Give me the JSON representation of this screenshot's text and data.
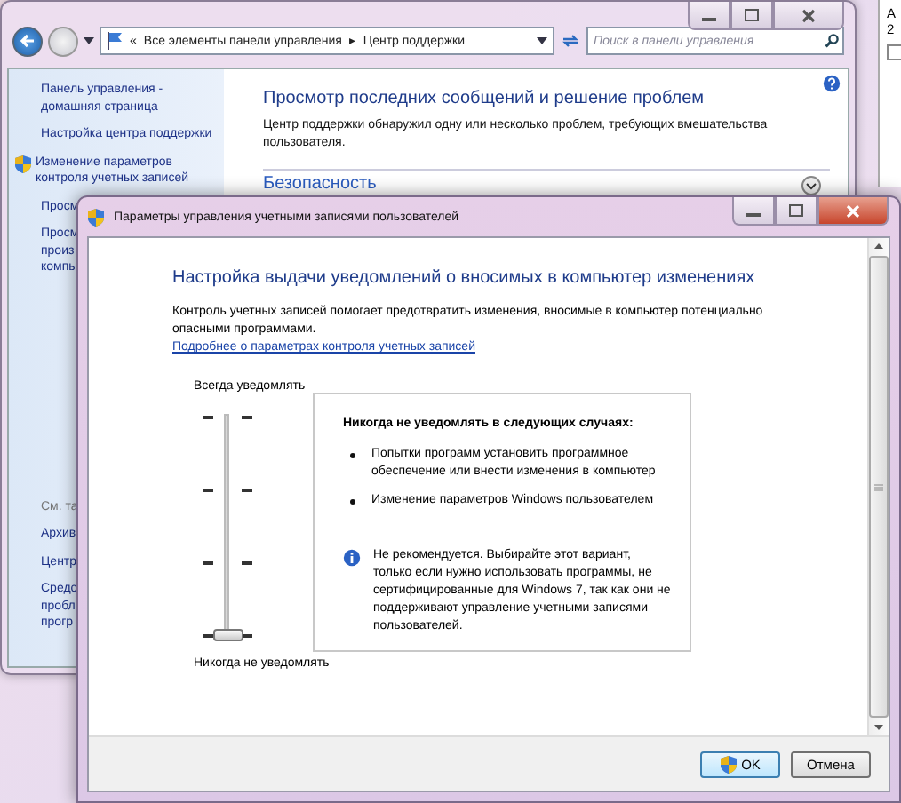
{
  "control_panel": {
    "nav": {
      "breadcrumb": [
        "«",
        "Все элементы панели управления",
        "▸",
        "Центр поддержки"
      ],
      "search": {
        "placeholder": "Поиск в панели управления"
      }
    },
    "sidebar": {
      "links": [
        {
          "lines": [
            "Панель управления -",
            "домашняя страница"
          ],
          "shield": false
        },
        {
          "lines": [
            "Настройка центра поддержки"
          ],
          "shield": false
        },
        {
          "lines": [
            "Изменение параметров",
            "контроля учетных записей"
          ],
          "shield": true
        },
        {
          "lines": [
            "Просм"
          ],
          "shield": false
        },
        {
          "lines": [
            "Просм",
            "произ",
            "компь"
          ],
          "shield": false
        }
      ],
      "see_also": {
        "heading": "См. та",
        "links": [
          {
            "lines": [
              "Архив"
            ]
          },
          {
            "lines": [
              "Центр"
            ]
          },
          {
            "lines": [
              "Средс",
              "пробл",
              "прогр"
            ]
          }
        ]
      }
    },
    "main": {
      "title": "Просмотр последних сообщений и решение проблем",
      "description": "Центр поддержки обнаружил одну или несколько проблем, требующих вмешательства пользователя.",
      "section": "Безопасность"
    }
  },
  "side_window": {
    "texts": [
      "А",
      "2"
    ],
    "checkbox": {
      "checked": false
    }
  },
  "uac_dialog": {
    "window": {
      "title": "Параметры управления учетными записями пользователей"
    },
    "heading": "Настройка выдачи уведомлений о вносимых в компьютер изменениях",
    "description": "Контроль учетных записей помогает предотвратить изменения, вносимые в компьютер потенциально опасными программами.",
    "link": "Подробнее о параметрах контроля учетных записей",
    "slider": {
      "top_label": "Всегда уведомлять",
      "bottom_label": "Никогда не уведомлять",
      "level": 0
    },
    "info": {
      "heading": "Никогда не уведомлять в следующих случаях:",
      "bullets": [
        "Попытки программ установить программное обеспечение или внести изменения в компьютер",
        "Изменение параметров Windows пользователем"
      ],
      "note": "Не рекомендуется. Выбирайте этот вариант, только если нужно использовать программы, не сертифицированные для Windows 7, так как они не поддерживают управление учетными записями пользователей."
    },
    "buttons": [
      {
        "label": "OK",
        "shield": true
      },
      {
        "label": "Отмена",
        "shield": false
      }
    ]
  }
}
